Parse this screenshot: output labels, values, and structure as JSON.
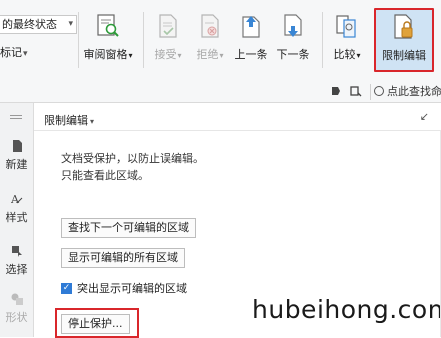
{
  "ribbon": {
    "display_combo": "的最终状态",
    "left_small": "标记",
    "review_pane": "审阅窗格",
    "accept": "接受",
    "reject": "拒绝",
    "previous": "上一条",
    "next": "下一条",
    "compare": "比较",
    "restrict_editing": "限制编辑"
  },
  "subbar": {
    "search_text": "点此查找命"
  },
  "sidebar": {
    "items": [
      {
        "label": "新建"
      },
      {
        "label": "样式"
      },
      {
        "label": "选择"
      },
      {
        "label": "形状"
      }
    ]
  },
  "panel": {
    "title": "限制编辑",
    "message_line1": "文档受保护，以防止误编辑。",
    "message_line2": "只能查看此区域。",
    "find_next_button": "查找下一个可编辑的区域",
    "show_all_button": "显示可编辑的所有区域",
    "highlight_checkbox_label": "突出显示可编辑的区域",
    "highlight_checked": true,
    "stop_protection_button": "停止保护..."
  },
  "watermark": "hubeihong.com",
  "colors": {
    "highlight_border": "#d9262b",
    "active_button_bg": "#cfe3f4",
    "checkbox_blue": "#2f7bd6"
  }
}
